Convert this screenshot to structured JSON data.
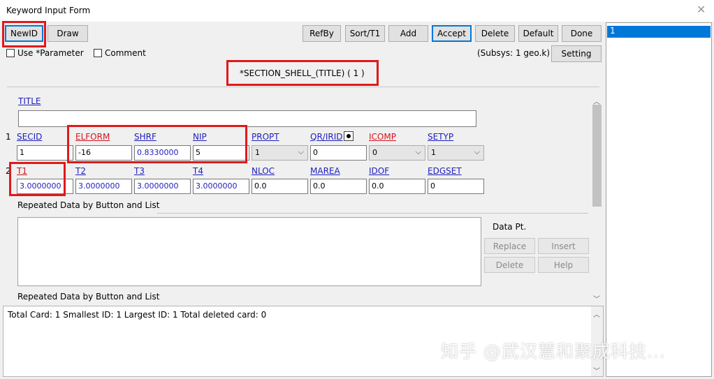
{
  "window": {
    "title": "Keyword Input Form",
    "close_glyph": "✕"
  },
  "toolbar": {
    "left_buttons": [
      "NewID",
      "Draw"
    ],
    "right_buttons": [
      "RefBy",
      "Sort/T1",
      "Add",
      "Accept",
      "Delete",
      "Default",
      "Done"
    ],
    "subsys_text": "(Subsys: 1 geo.k)",
    "setting_label": "Setting"
  },
  "options": {
    "use_parameter_label": "Use *Parameter",
    "comment_label": "Comment"
  },
  "keyword": {
    "title": "*SECTION_SHELL_(TITLE)    ( 1 )"
  },
  "form": {
    "title_label": "TITLE",
    "title_value": "",
    "card1": {
      "row_number": "1",
      "labels": [
        "SECID",
        "ELFORM",
        "SHRF",
        "NIP",
        "PROPT",
        "QR/IRID",
        "ICOMP",
        "SETYP"
      ],
      "secid": "1",
      "elform": "-16",
      "shrf": "0.8330000",
      "nip": "5",
      "propt": "1",
      "qr_irid": "0",
      "icomp": "0",
      "setyp": "1"
    },
    "card2": {
      "row_number": "2",
      "labels": [
        "T1",
        "T2",
        "T3",
        "T4",
        "NLOC",
        "MAREA",
        "IDOF",
        "EDGSET"
      ],
      "values": [
        "3.0000000",
        "3.0000000",
        "3.0000000",
        "3.0000000",
        "0.0",
        "0.0",
        "0.0",
        "0"
      ]
    },
    "repeated_label_1": "Repeated Data by Button and List",
    "repeated_label_2": "Repeated Data by Button and List",
    "data_pt_label": "Data Pt.",
    "data_buttons": [
      "Replace",
      "Insert",
      "Delete",
      "Help"
    ]
  },
  "status": {
    "text": "Total Card: 1    Smallest ID: 1    Largest ID: 1    Total deleted card:  0"
  },
  "id_list": {
    "items": [
      "1"
    ]
  },
  "watermark": {
    "text": "知乎 @武汉慧和聚成科技..."
  },
  "colors": {
    "accent": "#0078d7",
    "highlight_red": "#e0191b",
    "link_blue": "#1e1ebe",
    "required_red": "#d2141e"
  }
}
